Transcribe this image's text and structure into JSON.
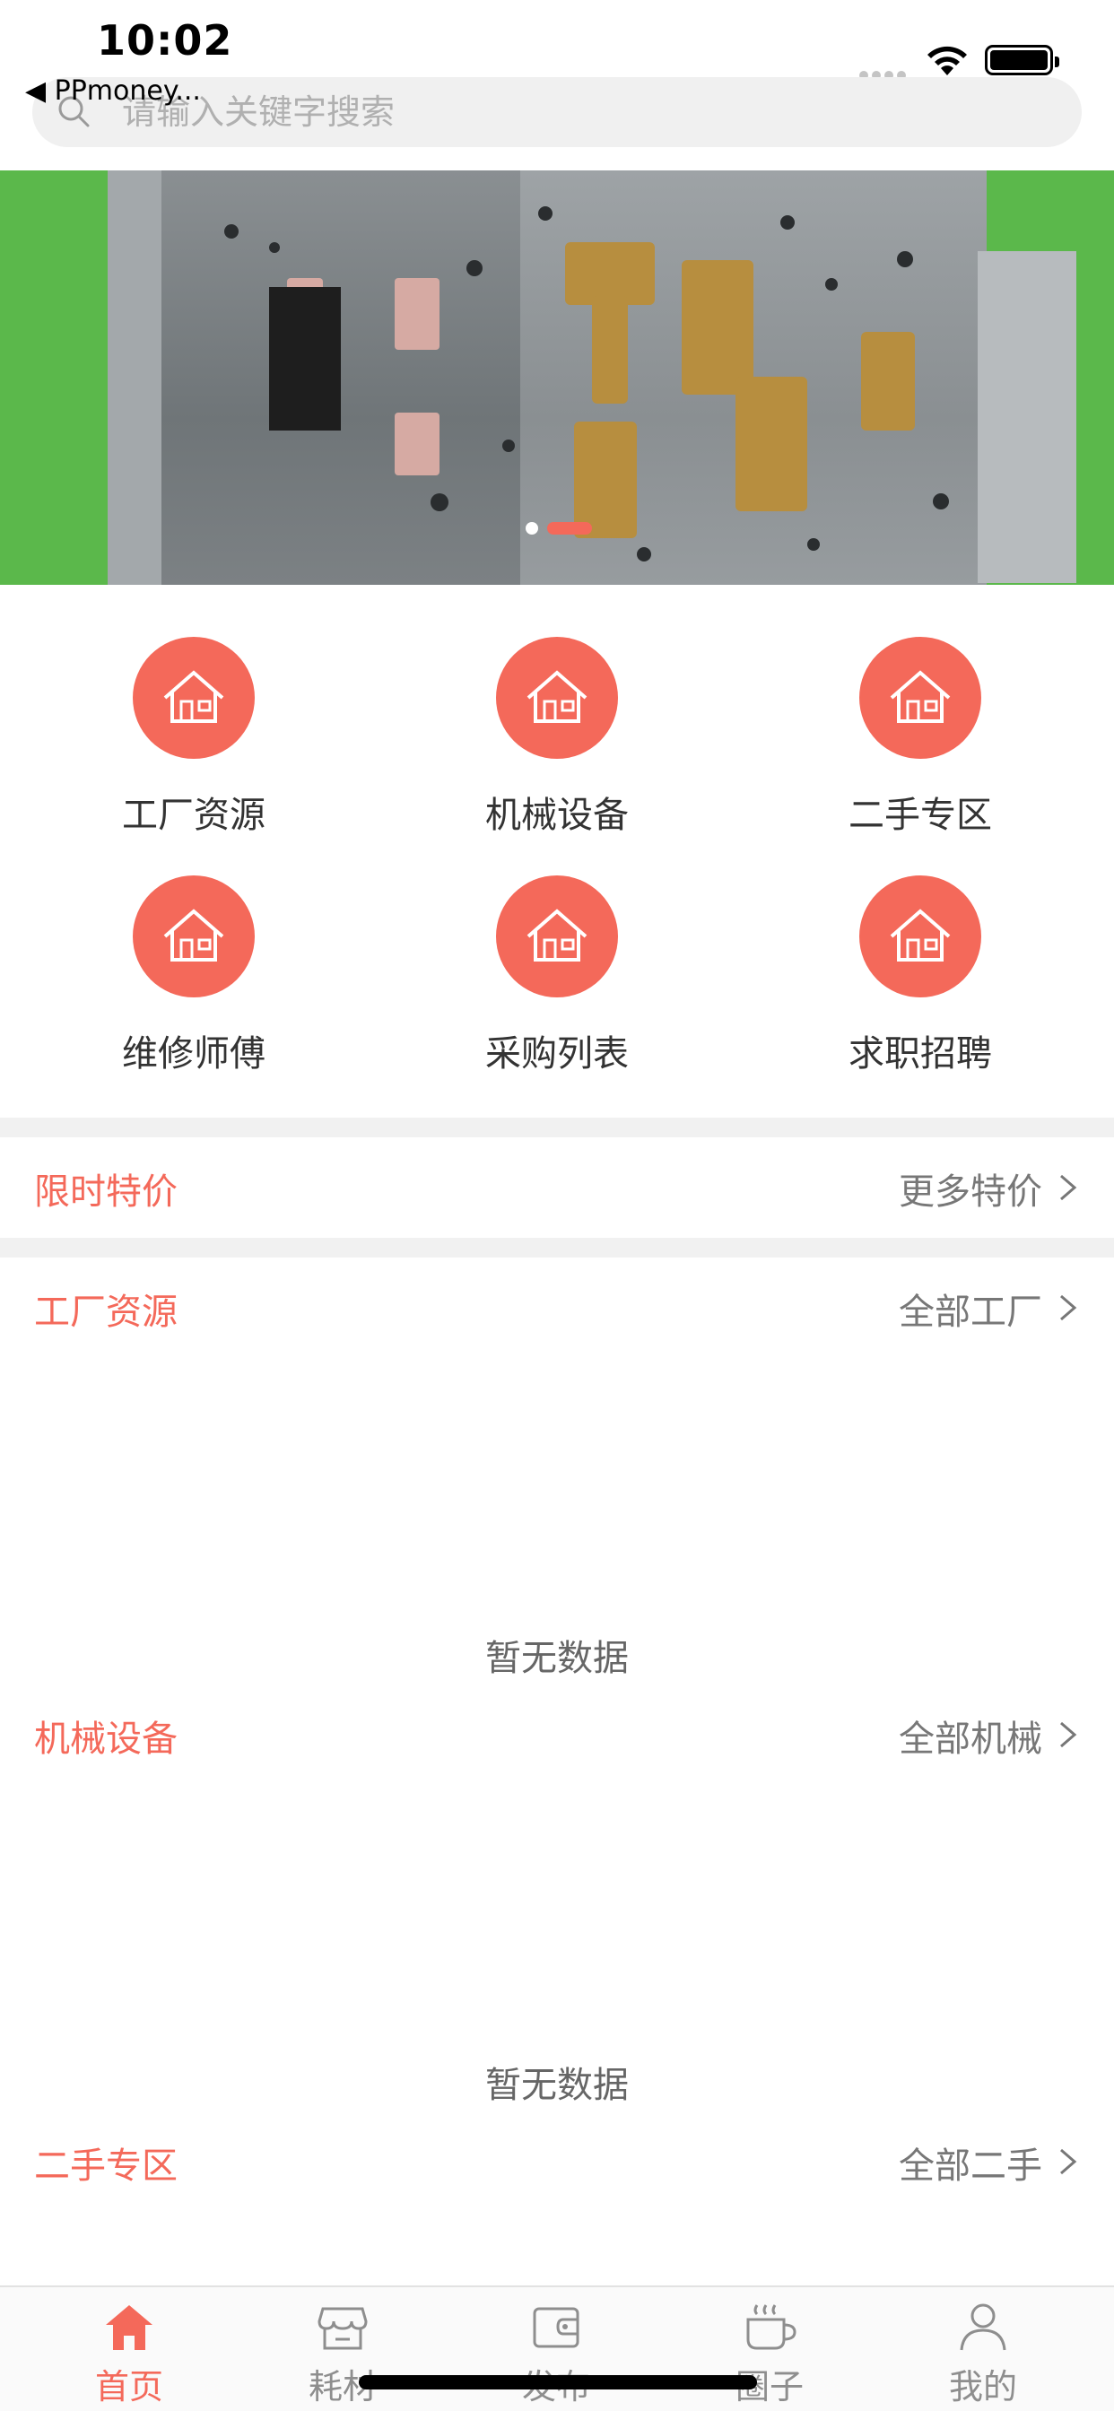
{
  "status_bar": {
    "time": "10:02",
    "back_app": "◀ PPmoney..."
  },
  "search": {
    "placeholder": "请输入关键字搜索",
    "icon": "search-icon"
  },
  "banner": {
    "slide_count": 2,
    "active_slide": 2
  },
  "categories": [
    {
      "label": "工厂资源",
      "icon": "house-icon"
    },
    {
      "label": "机械设备",
      "icon": "house-icon"
    },
    {
      "label": "二手专区",
      "icon": "house-icon"
    },
    {
      "label": "维修师傅",
      "icon": "house-icon"
    },
    {
      "label": "采购列表",
      "icon": "house-icon"
    },
    {
      "label": "求职招聘",
      "icon": "house-icon"
    }
  ],
  "sections": [
    {
      "title": "限时特价",
      "more": "更多特价"
    },
    {
      "title": "工厂资源",
      "more": "全部工厂",
      "empty": "暂无数据"
    },
    {
      "title": "机械设备",
      "more": "全部机械",
      "empty": "暂无数据"
    },
    {
      "title": "二手专区",
      "more": "全部二手"
    }
  ],
  "tabs": [
    {
      "label": "首页",
      "icon": "home-icon",
      "active": true
    },
    {
      "label": "耗材",
      "icon": "store-icon",
      "active": false
    },
    {
      "label": "发布",
      "icon": "wallet-icon",
      "active": false
    },
    {
      "label": "圈子",
      "icon": "coffee-cup-icon",
      "active": false
    },
    {
      "label": "我的",
      "icon": "user-icon",
      "active": false
    }
  ],
  "colors": {
    "accent": "#f4695a",
    "text": "#333333",
    "muted": "#777777",
    "divider": "#f1f1f1"
  }
}
